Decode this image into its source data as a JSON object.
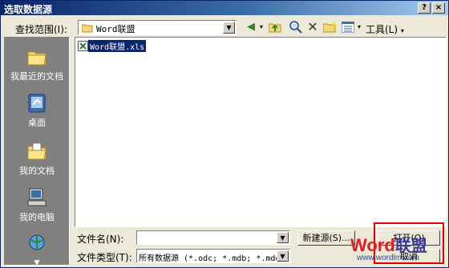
{
  "window": {
    "title": "选取数据源",
    "help_label": "?",
    "close_label": "×"
  },
  "lookin": {
    "label": "查找范围(I):",
    "value": "Word联盟"
  },
  "toolbar": {
    "tools_label": "工具(L)"
  },
  "places": [
    {
      "label": "我最近的文档",
      "icon": "recent-docs-icon"
    },
    {
      "label": "桌面",
      "icon": "desktop-icon"
    },
    {
      "label": "我的文档",
      "icon": "my-documents-icon"
    },
    {
      "label": "我的电脑",
      "icon": "my-computer-icon"
    },
    {
      "label": "",
      "icon": "network-places-icon"
    }
  ],
  "files": [
    {
      "name": "Word联盟.xls",
      "selected": true
    }
  ],
  "filename": {
    "label": "文件名(N):",
    "value": ""
  },
  "filetype": {
    "label": "文件类型(T):",
    "value": "所有数据源 (*.odc; *.mdb; *.mde"
  },
  "buttons": {
    "new_source": "新建源(S)...",
    "open": "打开(O)",
    "cancel": "取消"
  },
  "watermark": {
    "word": "Word",
    "lianmeng": "联盟",
    "url": "www.wordlm.com"
  }
}
